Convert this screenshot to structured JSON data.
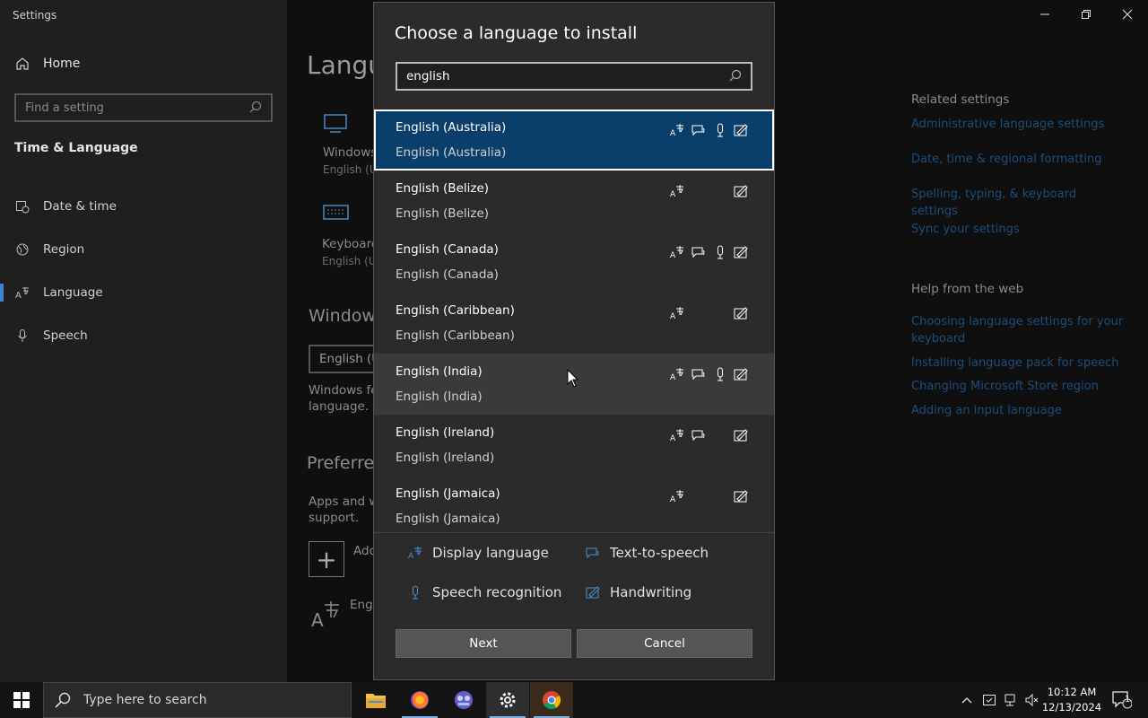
{
  "app": {
    "title": "Settings"
  },
  "nav": {
    "home_label": "Home",
    "search_placeholder": "Find a setting",
    "section": "Time & Language",
    "items": [
      {
        "label": "Date & time",
        "icon": "calendar-clock-icon"
      },
      {
        "label": "Region",
        "icon": "globe-icon"
      },
      {
        "label": "Language",
        "icon": "language-icon",
        "active": true
      },
      {
        "label": "Speech",
        "icon": "microphone-icon"
      }
    ]
  },
  "main": {
    "title": "Langu",
    "windows_display": {
      "label": "Windows",
      "sub": "English (U"
    },
    "keyboard": {
      "label": "Keyboard",
      "sub": "English (U"
    },
    "windows_heading": "Window",
    "windows_input_value": "English (U",
    "windows_text_line1": "Windows fe",
    "windows_text_line2": "language.",
    "preferred_heading": "Preferre",
    "apps_text_line1": "Apps and w",
    "apps_text_line2": "support.",
    "add_label": "Add",
    "lang_entry": "Engl"
  },
  "related": {
    "heading": "Related settings",
    "links": [
      "Administrative language settings",
      "Date, time & regional formatting",
      "Spelling, typing, & keyboard settings",
      "Sync your settings"
    ],
    "help_heading": "Help from the web",
    "help_links": [
      "Choosing language settings for your keyboard",
      "Installing language pack for speech",
      "Changing Microsoft Store region",
      "Adding an input language"
    ]
  },
  "dialog": {
    "title": "Choose a language to install",
    "search_value": "english",
    "languages": [
      {
        "name": "English (Australia)",
        "native": "English (Australia)",
        "display": true,
        "tts": true,
        "speech": true,
        "handwriting": true,
        "state": "selected"
      },
      {
        "name": "English (Belize)",
        "native": "English (Belize)",
        "display": true,
        "tts": false,
        "speech": false,
        "handwriting": true,
        "state": ""
      },
      {
        "name": "English (Canada)",
        "native": "English (Canada)",
        "display": true,
        "tts": true,
        "speech": true,
        "handwriting": true,
        "state": ""
      },
      {
        "name": "English (Caribbean)",
        "native": "English (Caribbean)",
        "display": true,
        "tts": false,
        "speech": false,
        "handwriting": true,
        "state": ""
      },
      {
        "name": "English (India)",
        "native": "English (India)",
        "display": true,
        "tts": true,
        "speech": true,
        "handwriting": true,
        "state": "hover"
      },
      {
        "name": "English (Ireland)",
        "native": "English (Ireland)",
        "display": true,
        "tts": true,
        "speech": false,
        "handwriting": true,
        "state": ""
      },
      {
        "name": "English (Jamaica)",
        "native": "English (Jamaica)",
        "display": true,
        "tts": false,
        "speech": false,
        "handwriting": true,
        "state": ""
      }
    ],
    "legend": {
      "display": "Display language",
      "tts": "Text-to-speech",
      "speech": "Speech recognition",
      "handwriting": "Handwriting"
    },
    "next_label": "Next",
    "cancel_label": "Cancel"
  },
  "taskbar": {
    "search_placeholder": "Type here to search",
    "apps": [
      "file-explorer-icon",
      "firefox-icon",
      "game-app-icon",
      "settings-icon",
      "chrome-icon"
    ],
    "time": "10:12 AM",
    "date": "12/13/2024",
    "notification_count": "1"
  },
  "colors": {
    "accent": "#0b3f6b",
    "link": "#1c4d7a",
    "legend_icon": "#4a8fd6"
  }
}
